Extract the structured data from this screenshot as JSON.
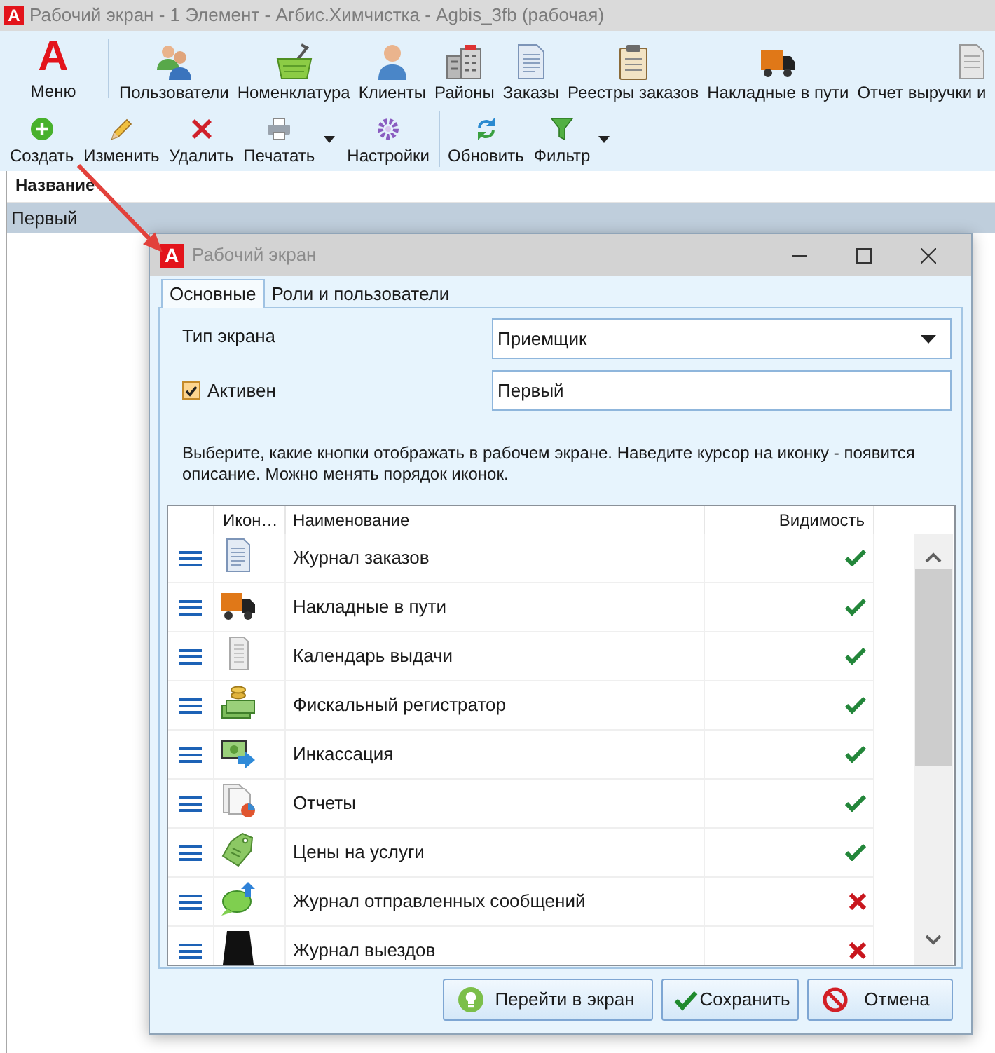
{
  "window": {
    "logo": "A",
    "title": "Рабочий экран - 1 Элемент - Агбис.Химчистка - Agbis_3fb (рабочая)"
  },
  "ribbon": {
    "menu": {
      "logo": "A",
      "label": "Меню"
    },
    "items": [
      {
        "label": "Пользователи"
      },
      {
        "label": "Номенклатура"
      },
      {
        "label": "Клиенты"
      },
      {
        "label": "Районы"
      },
      {
        "label": "Заказы"
      },
      {
        "label": "Реестры заказов"
      },
      {
        "label": "Накладные в пути"
      },
      {
        "label": "Отчет выручки и"
      }
    ]
  },
  "toolbar": {
    "groups": [
      [
        {
          "label": "Создать",
          "has_menu": false
        },
        {
          "label": "Изменить",
          "has_menu": false
        },
        {
          "label": "Удалить",
          "has_menu": false
        },
        {
          "label": "Печатать",
          "has_menu": true
        },
        {
          "label": "Настройки",
          "has_menu": false
        }
      ],
      [
        {
          "label": "Обновить",
          "has_menu": false
        },
        {
          "label": "Фильтр",
          "has_menu": true
        }
      ]
    ]
  },
  "table": {
    "columns": [
      "Название"
    ],
    "rows": [
      {
        "cells": [
          "Первый"
        ],
        "selected": true
      }
    ]
  },
  "dialog": {
    "logo": "A",
    "title": "Рабочий экран",
    "tabs": [
      {
        "label": "Основные",
        "selected": true
      },
      {
        "label": "Роли и пользователи",
        "selected": false
      }
    ],
    "screen_type": {
      "label": "Тип экрана",
      "value": "Приемщик"
    },
    "active": {
      "label": "Активен",
      "checked": true
    },
    "name": {
      "value": "Первый"
    },
    "hint": "Выберите, какие кнопки отображать в рабочем экране. Наведите курсор на иконку - появится описание. Можно менять порядок иконок.",
    "grid": {
      "columns": [
        {
          "label": "Икон…"
        },
        {
          "label": "Наименование"
        },
        {
          "label": "Видимость"
        }
      ],
      "rows": [
        {
          "name": "Журнал заказов",
          "visible": true
        },
        {
          "name": "Накладные в пути",
          "visible": true
        },
        {
          "name": "Календарь выдачи",
          "visible": true
        },
        {
          "name": "Фискальный регистратор",
          "visible": true
        },
        {
          "name": "Инкассация",
          "visible": true
        },
        {
          "name": "Отчеты",
          "visible": true
        },
        {
          "name": "Цены на услуги",
          "visible": true
        },
        {
          "name": "Журнал отправленных сообщений",
          "visible": false
        },
        {
          "name": "Журнал выездов",
          "visible": false
        }
      ]
    },
    "buttons": [
      {
        "label": "Перейти в экран"
      },
      {
        "label": "Сохранить"
      },
      {
        "label": "Отмена"
      }
    ]
  }
}
